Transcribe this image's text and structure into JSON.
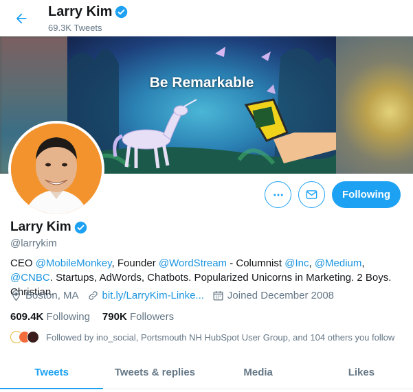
{
  "header": {
    "name": "Larry Kim",
    "tweet_count": "69.3K Tweets"
  },
  "banner": {
    "title": "Be Remarkable"
  },
  "profile": {
    "name": "Larry Kim",
    "handle": "@larrykim",
    "bio": {
      "p1": "CEO ",
      "m1": "@MobileMonkey",
      "p2": ", Founder ",
      "m2": "@WordStream",
      "p3": " - Columnist ",
      "m3": "@Inc",
      "p4": ", ",
      "m4": "@Medium",
      "p5": ", ",
      "m5": "@CNBC",
      "p6": ". Startups, AdWords, Chatbots. Popularized Unicorns in Marketing. 2 Boys. Christian."
    },
    "location": "Boston, MA",
    "website": "bit.ly/LarryKim-Linke...",
    "joined": "Joined December 2008"
  },
  "stats": {
    "following_count": "609.4K",
    "following_label": "Following",
    "followers_count": "790K",
    "followers_label": "Followers"
  },
  "followed_by": "Followed by ino_social, Portsmouth NH HubSpot User Group, and 104 others you follow",
  "buttons": {
    "follow": "Following"
  },
  "tabs": [
    {
      "label": "Tweets",
      "active": true
    },
    {
      "label": "Tweets & replies"
    },
    {
      "label": "Media"
    },
    {
      "label": "Likes"
    }
  ],
  "colors": {
    "accent": "#1da1f2",
    "link": "#1b95e0",
    "muted": "#657786",
    "text": "#14171a"
  },
  "icons": [
    "back-arrow-icon",
    "verified-badge-icon",
    "more-icon",
    "message-icon",
    "location-icon",
    "link-icon",
    "calendar-icon"
  ]
}
